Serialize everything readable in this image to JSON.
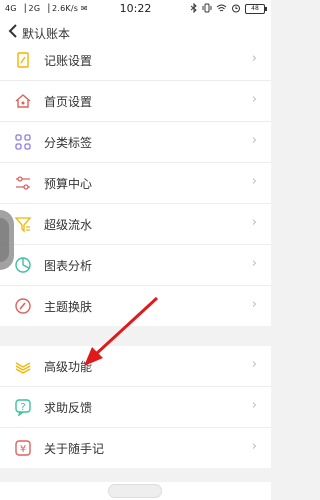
{
  "status_bar": {
    "left": "4G ▕ 2G ▕ 2.6K/s ✉",
    "time": "10:22",
    "icons": [
      "bluetooth-icon",
      "vibrate-icon",
      "wifi-icon",
      "alarm-icon"
    ],
    "battery": "48"
  },
  "nav": {
    "back_icon": "chevron-left-icon",
    "title": "默认账本"
  },
  "menu_groups": [
    [
      {
        "label": "记账设置",
        "icon": "document-pen-icon",
        "color": "#f4b400"
      },
      {
        "label": "首页设置",
        "icon": "home-icon",
        "color": "#e0605a"
      },
      {
        "label": "分类标签",
        "icon": "grid-icon",
        "color": "#8c7ce0"
      },
      {
        "label": "预算中心",
        "icon": "sliders-icon",
        "color": "#e0605a"
      },
      {
        "label": "超级流水",
        "icon": "filter-icon",
        "color": "#f4b400"
      },
      {
        "label": "图表分析",
        "icon": "pie-chart-icon",
        "color": "#3cc0a0"
      },
      {
        "label": "主题换肤",
        "icon": "paint-icon",
        "color": "#e0605a"
      }
    ],
    [
      {
        "label": "高级功能",
        "icon": "layers-icon",
        "color": "#f4b400"
      },
      {
        "label": "求助反馈",
        "icon": "help-icon",
        "color": "#3cc0a0"
      },
      {
        "label": "关于随手记",
        "icon": "yen-badge-icon",
        "color": "#e0605a"
      }
    ]
  ],
  "annotation": {
    "arrow_color": "#e0191b",
    "arrow_icon": "red-arrow-icon"
  }
}
